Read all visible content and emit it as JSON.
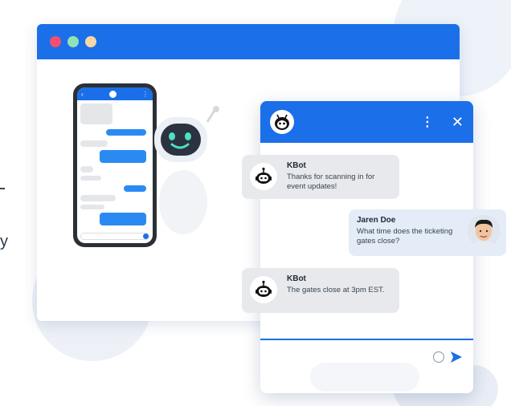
{
  "colors": {
    "brand_blue": "#1b6fe8",
    "bubble_grey": "#e7e9ec",
    "user_bubble": "#e4ecf7"
  },
  "browser": {
    "window_dots": [
      "#f0506e",
      "#8fe3b5",
      "#f6d7a7"
    ]
  },
  "edge_text": "y",
  "chat": {
    "header_icons": [
      "bot-logo-icon",
      "more-vertical-icon",
      "close-icon"
    ],
    "close_glyph": "✕",
    "more_glyph": "⋮",
    "messages": [
      {
        "sender": "KBot",
        "text": "Thanks for scanning in for event updates!"
      },
      {
        "sender": "Jaren Doe",
        "text": "What time does the ticketing gates close?"
      },
      {
        "sender": "KBot",
        "text": "The gates close at 3pm EST."
      }
    ],
    "footer_icons": [
      "emoji-icon",
      "send-icon"
    ]
  }
}
